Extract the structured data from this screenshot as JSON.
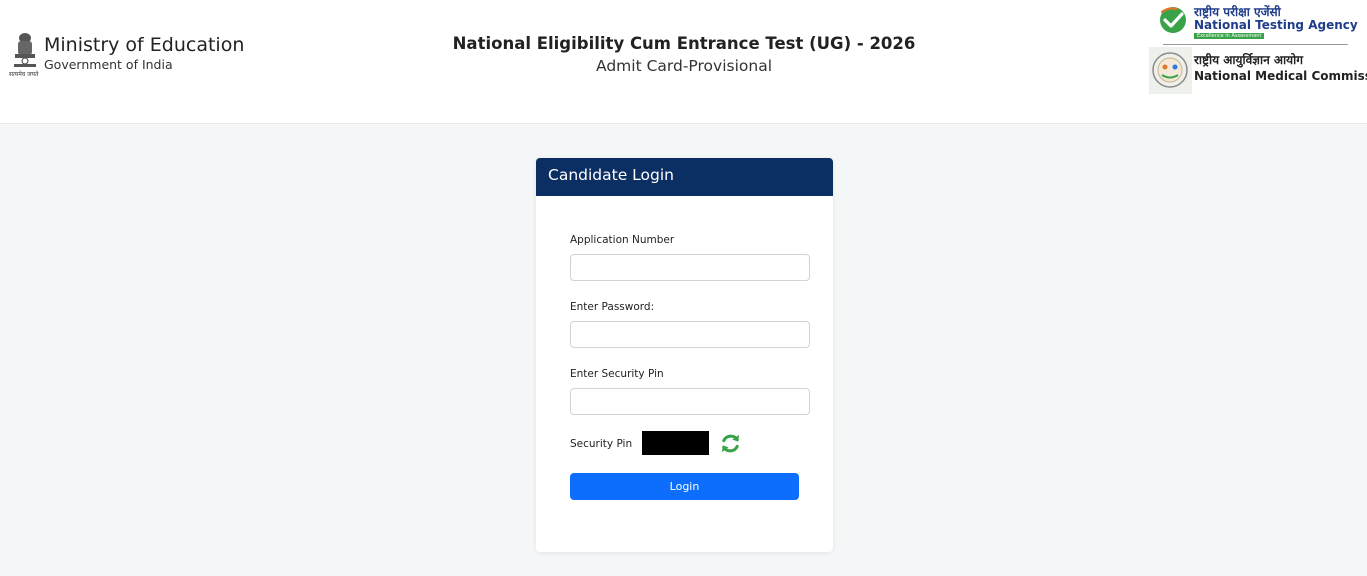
{
  "header": {
    "ministry": {
      "emblem_icon": "national-emblem-icon",
      "emblem_motto": "सत्यमेव जयते",
      "title": "Ministry of Education",
      "subtitle": "Government of India"
    },
    "exam": {
      "title": "National Eligibility Cum Entrance Test (UG) - 2026",
      "subtitle": "Admit Card-Provisional"
    },
    "nta": {
      "icon": "nta-check-logo-icon",
      "hindi": "राष्ट्रीय परीक्षा एजेंसी",
      "name": "National Testing Agency",
      "tagline": "Excellence in Assessment"
    },
    "nmc": {
      "icon": "nmc-logo-icon",
      "hindi": "राष्ट्रीय आयुर्विज्ञान आयोग",
      "name": "National Medical Commission"
    }
  },
  "login": {
    "title": "Candidate Login",
    "application_number_label": "Application Number",
    "application_number_value": "",
    "password_label": "Enter Password:",
    "password_value": "",
    "security_pin_label": "Enter Security Pin",
    "security_pin_value": "",
    "captcha_label": "Security Pin",
    "refresh_icon": "refresh-icon",
    "login_button": "Login"
  },
  "colors": {
    "header_bg": "#ffffff",
    "page_bg": "#f5f6f7",
    "card_header": "#0b2f63",
    "button": "#0d6efd",
    "nta_blue": "#1f3d8a",
    "nta_green": "#3aa34a"
  }
}
